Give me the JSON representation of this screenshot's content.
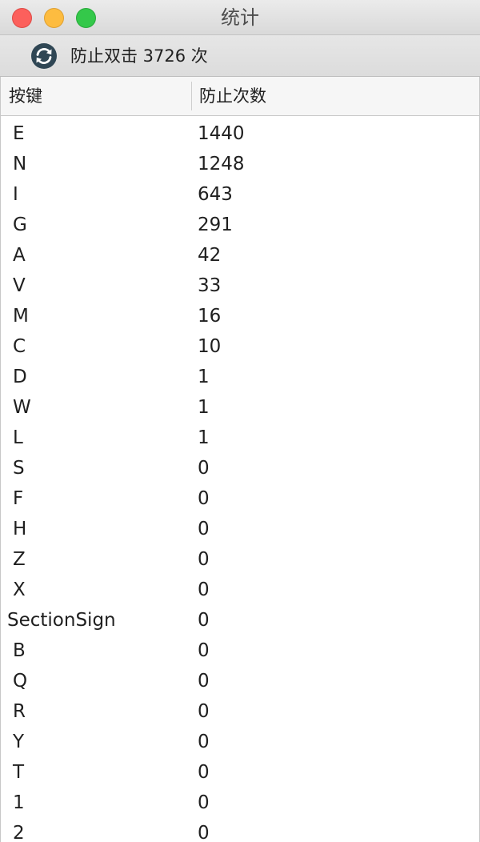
{
  "window": {
    "title": "统计"
  },
  "toolbar": {
    "status": "防止双击 3726 次",
    "refresh_icon": "refresh-icon"
  },
  "table": {
    "columns": [
      "按键",
      "防止次数"
    ],
    "rows": [
      [
        "E",
        "1440"
      ],
      [
        "N",
        "1248"
      ],
      [
        "I",
        "643"
      ],
      [
        "G",
        "291"
      ],
      [
        "A",
        "42"
      ],
      [
        "V",
        "33"
      ],
      [
        "M",
        "16"
      ],
      [
        "C",
        "10"
      ],
      [
        "D",
        "1"
      ],
      [
        "W",
        "1"
      ],
      [
        "L",
        "1"
      ],
      [
        "S",
        "0"
      ],
      [
        "F",
        "0"
      ],
      [
        "H",
        "0"
      ],
      [
        "Z",
        "0"
      ],
      [
        "X",
        "0"
      ],
      [
        "SectionSign",
        "0"
      ],
      [
        "B",
        "0"
      ],
      [
        "Q",
        "0"
      ],
      [
        "R",
        "0"
      ],
      [
        "Y",
        "0"
      ],
      [
        "T",
        "0"
      ],
      [
        "1",
        "0"
      ],
      [
        "2",
        "0"
      ]
    ]
  },
  "colors": {
    "close": "#fc605c",
    "minimize": "#fdbc40",
    "maximize": "#34c84a",
    "icon": "#2f4654"
  }
}
